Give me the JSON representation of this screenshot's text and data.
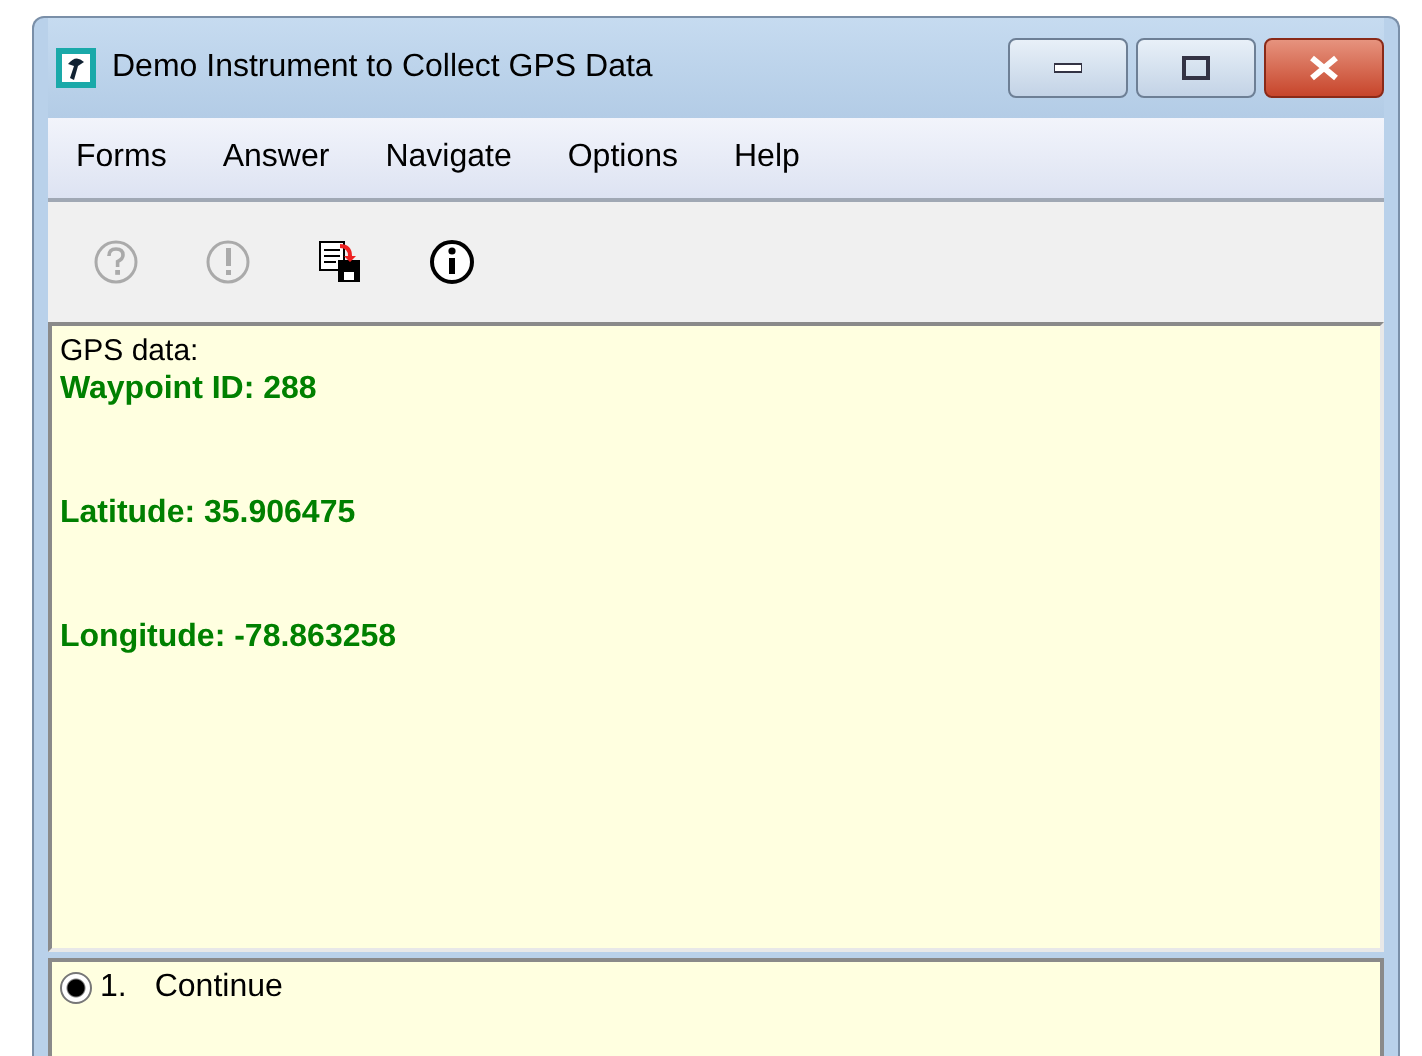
{
  "window": {
    "title": "Demo Instrument to Collect GPS Data"
  },
  "menu": [
    "Forms",
    "Answer",
    "Navigate",
    "Options",
    "Help"
  ],
  "toolbar": [
    {
      "kind": "help",
      "disabled": true
    },
    {
      "kind": "alert",
      "disabled": true
    },
    {
      "kind": "save",
      "disabled": false
    },
    {
      "kind": "info",
      "disabled": false
    }
  ],
  "question": [
    {
      "text": "GPS data:",
      "emphasis": false
    },
    {
      "text": "Waypoint ID: 288",
      "emphasis": true
    },
    {
      "text": "Latitude: 35.906475",
      "emphasis": true
    },
    {
      "text": "Longitude: -78.863258",
      "emphasis": true
    }
  ],
  "answers": [
    {
      "number": "1.",
      "label": "Continue",
      "selected": true
    }
  ]
}
